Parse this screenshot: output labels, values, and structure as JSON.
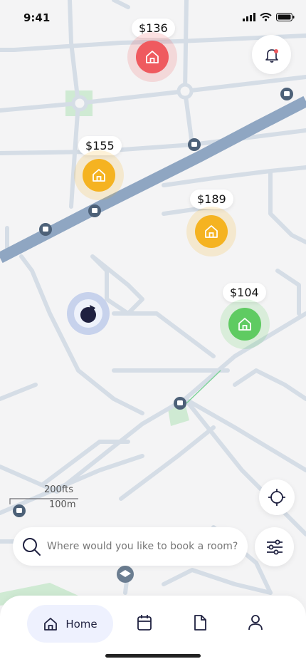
{
  "status": {
    "time": "9:41"
  },
  "markers": [
    {
      "price": "$136",
      "status": "red"
    },
    {
      "price": "$155",
      "status": "orange"
    },
    {
      "price": "$189",
      "status": "orange"
    },
    {
      "price": "$104",
      "status": "green"
    }
  ],
  "scale": {
    "imperial": "200fts",
    "metric": "100m"
  },
  "search": {
    "placeholder": "Where would you like to book a room?"
  },
  "nav": {
    "home_label": "Home"
  },
  "colors": {
    "red": "#ef5a5f",
    "orange": "#f5b321",
    "green": "#5fcb62",
    "road": "#d5dde6",
    "highway": "#8fa6c2",
    "accent": "#1f2140"
  }
}
